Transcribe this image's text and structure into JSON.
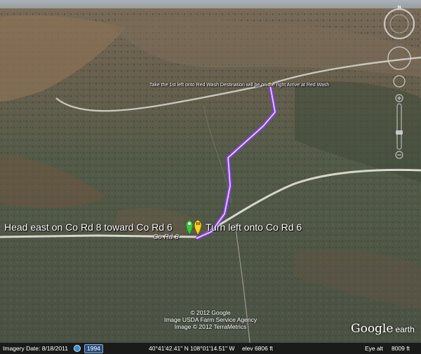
{
  "directions": {
    "start": "Head east on Co Rd 8 toward Co Rd 6",
    "turn": "Turn left onto Co Rd 6",
    "destination": "Take the 1st left onto Red Wash Destination will be on the right Arrive at Red Wash"
  },
  "road_label": "Co Rd 8",
  "copyright": [
    "© 2012 Google",
    "Image USDA Farm Service Agency",
    "Image © 2012 TerraMetrics"
  ],
  "brand": {
    "name": "Google",
    "suffix": "earth"
  },
  "compass": {
    "north": "N"
  },
  "status": {
    "imagery_date": "Imagery Date: 8/18/2011",
    "history_year": "1994",
    "coordinates": "40°41'42.41\" N 108°01'14.51\" W",
    "elevation": "elev 6806 ft",
    "eye_alt_label": "Eye alt",
    "eye_alt_value": "8009 ft"
  },
  "colors": {
    "route": "#8a3cf0",
    "route_core": "#e8dcff",
    "status_bar": "#1a1a1a",
    "start_pin": "#3cc43c",
    "turn_pin": "#f5d41c"
  }
}
